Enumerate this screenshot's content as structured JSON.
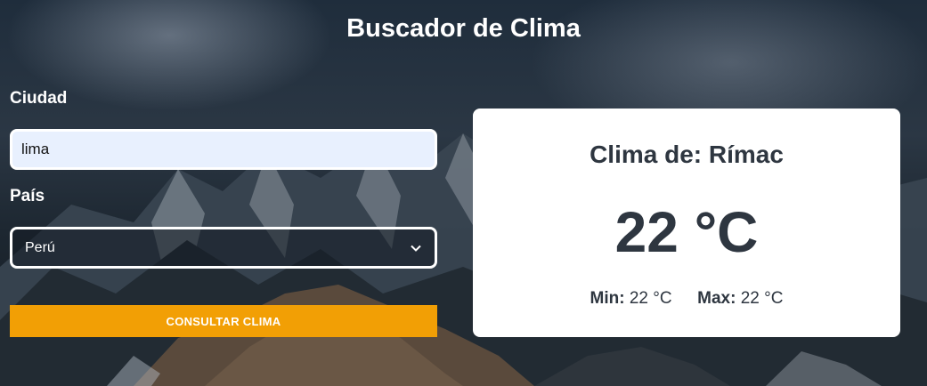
{
  "page": {
    "title": "Buscador de Clima"
  },
  "form": {
    "city_label": "Ciudad",
    "city_value": "lima",
    "country_label": "País",
    "country_selected": "Perú",
    "submit_label": "CONSULTAR CLIMA"
  },
  "weather": {
    "title_prefix": "Clima de:",
    "location": "Rímac",
    "temperature": "22 °C",
    "min_label": "Min:",
    "min_value": "22 °C",
    "max_label": "Max:",
    "max_value": "22 °C"
  },
  "icons": {
    "select_chevron": "chevron-down-icon"
  },
  "colors": {
    "accent": "#f29f05",
    "input_bg": "#e8f0fe",
    "card_text": "#2e3640",
    "card_bg": "#ffffff"
  }
}
